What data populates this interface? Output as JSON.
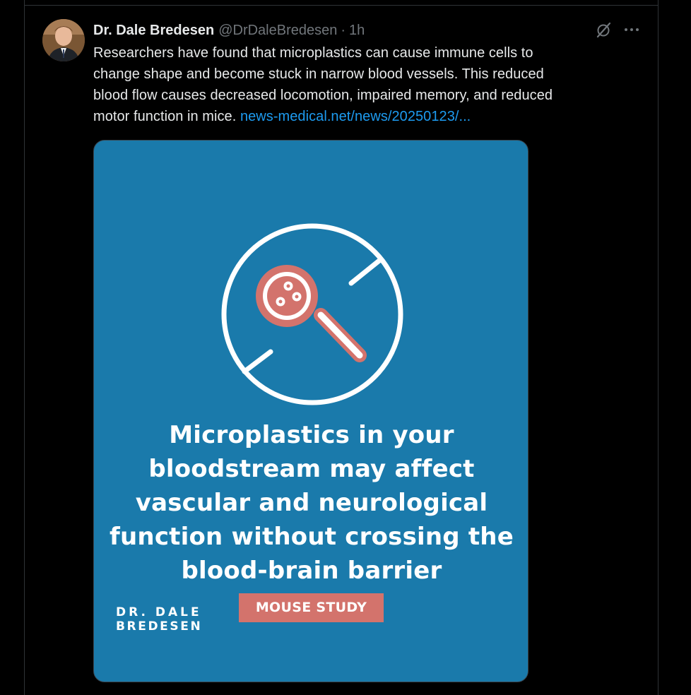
{
  "tweet": {
    "display_name": "Dr. Dale Bredesen",
    "handle": "@DrDaleBredesen",
    "separator": "·",
    "time": "1h",
    "text_lines": [
      "Researchers have found that microplastics can cause immune cells to",
      "change shape and become stuck in narrow blood vessels. This reduced",
      "blood flow causes decreased locomotion, impaired memory, and reduced",
      "motor function in mice. "
    ],
    "link_text": "news-medical.net/news/20250123/..."
  },
  "media": {
    "headline_lines": [
      "Microplastics in your",
      "bloodstream may affect",
      "vascular and neurological",
      "function without crossing the",
      "blood-brain barrier"
    ],
    "badge": "MOUSE STUDY",
    "brand_line1": "DR. DALE",
    "brand_line2": "BREDESEN",
    "background_color": "#1a7aab",
    "accent_color": "#d3736c"
  },
  "icons": {
    "avatar": "profile-photo",
    "grok": "grok-icon",
    "more": "more-icon",
    "media_illustration": "no-sign-magnifier-icon"
  },
  "colors": {
    "background": "#000000",
    "text": "#e7e9ea",
    "muted": "#71767b",
    "link": "#1d9bf0"
  }
}
